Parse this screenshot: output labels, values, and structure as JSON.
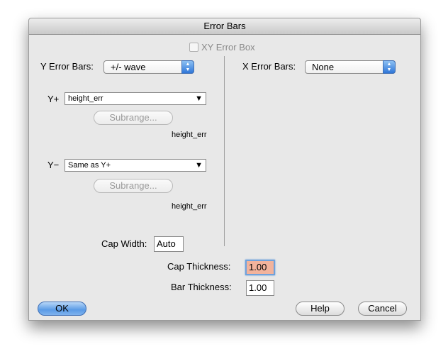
{
  "window": {
    "title": "Error Bars"
  },
  "xy_error_box": {
    "label": "XY Error Box"
  },
  "y_error": {
    "label": "Y Error Bars:",
    "mode": "+/- wave",
    "y_plus": {
      "label": "Y+",
      "value": "height_err",
      "subrange_label": "Subrange...",
      "range_caption": "height_err"
    },
    "y_minus": {
      "label": "Y−",
      "value": "Same as Y+",
      "subrange_label": "Subrange...",
      "range_caption": "height_err"
    }
  },
  "x_error": {
    "label": "X Error Bars:",
    "mode": "None"
  },
  "cap_width": {
    "label": "Cap Width:",
    "value": "Auto"
  },
  "cap_thickness": {
    "label": "Cap Thickness:",
    "value": "1.00"
  },
  "bar_thickness": {
    "label": "Bar Thickness:",
    "value": "1.00"
  },
  "buttons": {
    "ok": "OK",
    "help": "Help",
    "cancel": "Cancel"
  },
  "icons": {
    "popup_stepper": "stepper-arrows-icon",
    "select_arrow": "triangle-down-icon"
  },
  "colors": {
    "accent": "#3f7fdc",
    "focus_fill": "#f2b39c"
  }
}
